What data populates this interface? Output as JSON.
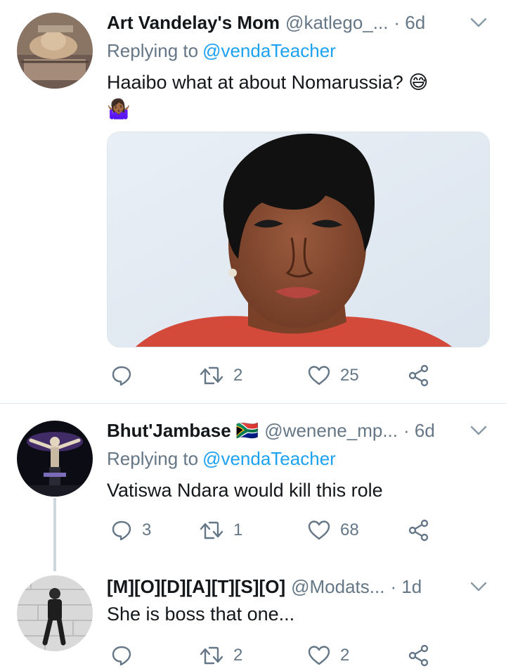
{
  "tweets": [
    {
      "name": "Art Vandelay's Mom",
      "handle": "@katlego_...",
      "time": "· 6d",
      "reply_prefix": "Replying to",
      "reply_to": "@vendaTeacher",
      "text_line1": "Haaibo what at about Nomarussia? 😅",
      "text_line2": "🤷🏾‍♀️",
      "replies": "",
      "retweets": "2",
      "likes": "25"
    },
    {
      "name": "Bhut'Jambase 🇿🇦",
      "handle": "@wenene_mp...",
      "time": "· 6d",
      "reply_prefix": "Replying to",
      "reply_to": "@vendaTeacher",
      "text": "Vatiswa Ndara would kill this role",
      "replies": "3",
      "retweets": "1",
      "likes": "68"
    },
    {
      "name": "[M][O][D][A][T][S][O]",
      "handle": "@Modats...",
      "time": "· 1d",
      "text": "She is boss that one...",
      "replies": "",
      "retweets": "2",
      "likes": "2"
    }
  ],
  "colors": {
    "text": "#14171a",
    "secondary": "#657786",
    "link": "#1da1f2",
    "divider": "#e1e8ed",
    "thread_line": "#ccd6dd"
  },
  "icons": [
    "reply-icon",
    "retweet-icon",
    "like-icon",
    "share-icon",
    "chevron-down-icon"
  ]
}
